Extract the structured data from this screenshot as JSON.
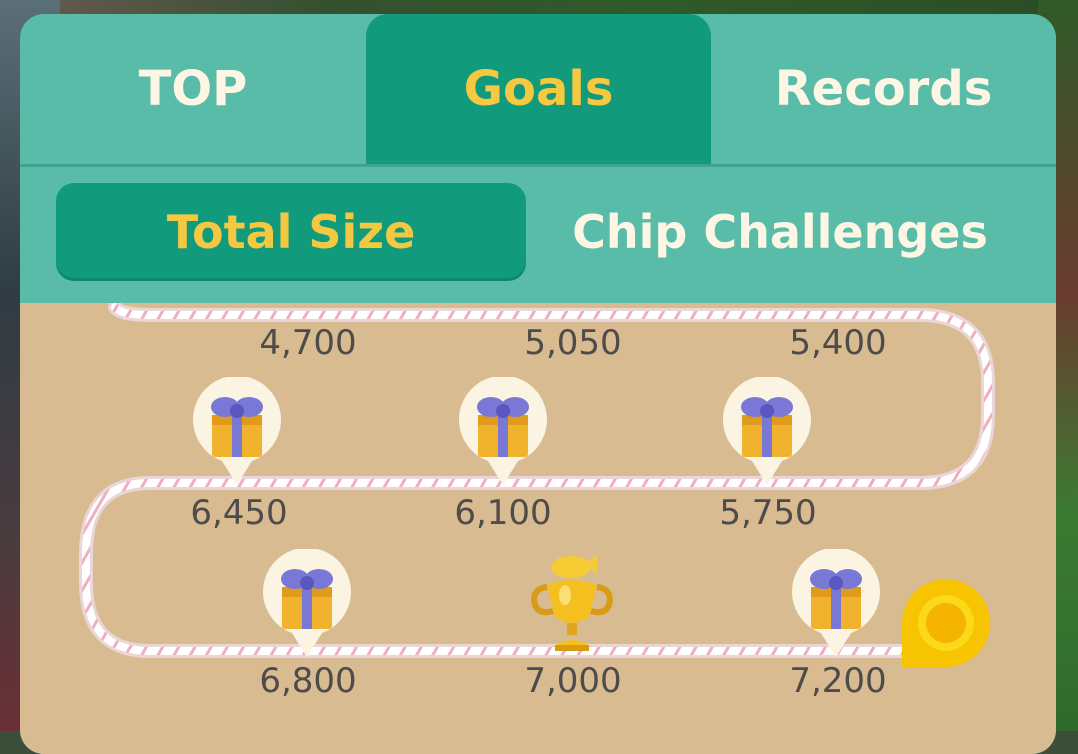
{
  "tabs": [
    "TOP",
    "Goals",
    "Records"
  ],
  "active_tab": "Goals",
  "subtabs": [
    "Total Size",
    "Chip Challenges"
  ],
  "active_subtab": "Total Size",
  "goals": {
    "row1": [
      "4,700",
      "5,050",
      "5,400"
    ],
    "row2": [
      "6,450",
      "6,100",
      "5,750"
    ],
    "row3": [
      "6,800",
      "7,000",
      "7,200"
    ]
  },
  "rewards": {
    "row1": [
      "gift-icon",
      "gift-icon",
      "gift-icon"
    ],
    "row2": [
      "gift-icon",
      "gift-icon",
      "gift-icon"
    ],
    "row3": [
      "gift-icon",
      "trophy-icon",
      "gift-icon"
    ]
  },
  "colors": {
    "tab_bar": "#58bca8",
    "active_tab": "#129a7d",
    "active_text": "#f5c842",
    "inactive_text": "#fdf6e4",
    "content_bg": "#d8bb90",
    "label_text": "#4f4b4b",
    "gift_box": "#f1b22e",
    "gift_ribbon": "#7a78d6",
    "trophy": "#f4c020",
    "progress_marker": "#f6c400"
  }
}
